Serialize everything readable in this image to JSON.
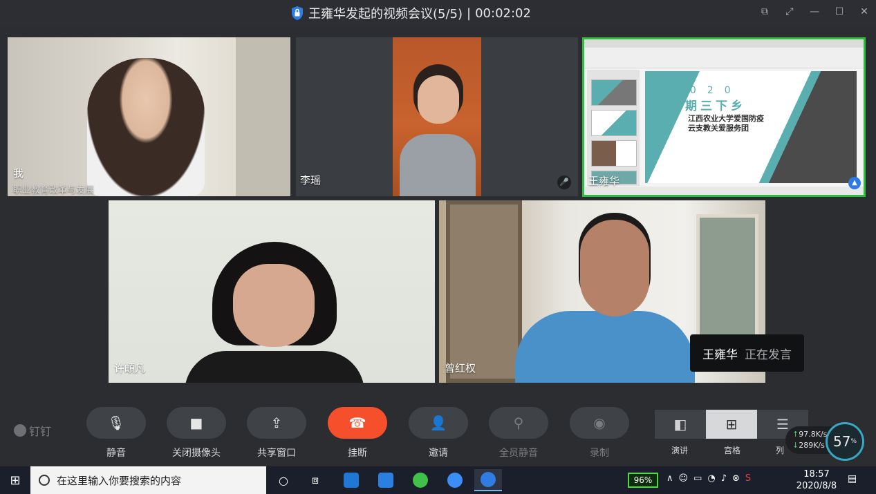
{
  "window": {
    "title": "王雍华发起的视频会议(5/5)",
    "separator": "|",
    "timer": "00:02:02"
  },
  "participants": [
    {
      "name": "我",
      "subtitle": "职业教育改革与发展"
    },
    {
      "name": "李瑶"
    },
    {
      "name": "王雍华"
    },
    {
      "name": "许頔凡"
    },
    {
      "name": "曾红权"
    }
  ],
  "shared_slide": {
    "year": "2020",
    "title": "暑期三下乡",
    "org_line1": "江西农业大学爱国防疫",
    "org_line2": "云支教关爱服务团"
  },
  "speaking": {
    "name": "王雍华",
    "status": "正在发言"
  },
  "brand": "钉钉",
  "controls": [
    {
      "label": "静音",
      "icon": "mic-icon"
    },
    {
      "label": "关闭摄像头",
      "icon": "camera-icon"
    },
    {
      "label": "共享窗口",
      "icon": "share-screen-icon"
    },
    {
      "label": "挂断",
      "icon": "hangup-icon"
    },
    {
      "label": "邀请",
      "icon": "invite-icon"
    },
    {
      "label": "全员静音",
      "icon": "mute-all-icon"
    },
    {
      "label": "录制",
      "icon": "record-icon"
    }
  ],
  "view_modes": [
    {
      "label": "演讲",
      "active": false
    },
    {
      "label": "宫格",
      "active": true
    },
    {
      "label": "列",
      "active": false
    }
  ],
  "network": {
    "up": "97.8",
    "down": "289",
    "unit": "K/s",
    "percent": "57",
    "percent_sign": "%"
  },
  "taskbar": {
    "search_placeholder": "在这里输入你要搜索的内容",
    "battery": "96%",
    "time": "18:57",
    "date": "2020/8/8"
  },
  "colors": {
    "accent_green": "#2bbd3c",
    "hangup": "#f5502b",
    "teal": "#5aaeb0"
  }
}
